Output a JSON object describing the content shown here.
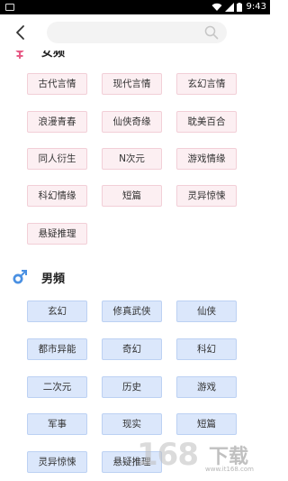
{
  "status_bar": {
    "time": "9:43",
    "icons": [
      "notification-icon",
      "wifi-icon",
      "signal-icon",
      "battery-icon"
    ]
  },
  "header": {
    "back_icon": "back-arrow-icon",
    "search_placeholder": "",
    "search_icon": "search-icon"
  },
  "female_section": {
    "title": "女频",
    "icon": "female-symbol-icon",
    "icon_color": "#e75b86",
    "tag_bg": "#fceff2",
    "tag_border": "#f2cfd7",
    "tags": [
      "古代言情",
      "现代言情",
      "玄幻言情",
      "浪漫青春",
      "仙侠奇缘",
      "耽美百合",
      "同人衍生",
      "N次元",
      "游戏情缘",
      "科幻情缘",
      "短篇",
      "灵异惊悚",
      "悬疑推理"
    ]
  },
  "male_section": {
    "title": "男頻",
    "icon": "male-symbol-icon",
    "icon_color": "#4a90e2",
    "tag_bg": "#dbe7fb",
    "tag_border": "#bcd1f3",
    "tags": [
      "玄幻",
      "修真武侠",
      "仙侠",
      "都市异能",
      "奇幻",
      "科幻",
      "二次元",
      "历史",
      "游戏",
      "军事",
      "现实",
      "短篇",
      "灵异惊悚",
      "悬疑推理"
    ]
  },
  "watermark": {
    "number": "168",
    "text": "下载",
    "url": "www.it168.com"
  }
}
